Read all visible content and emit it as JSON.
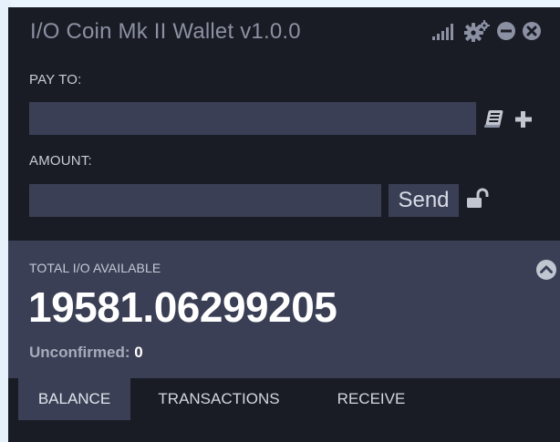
{
  "window": {
    "title": "I/O Coin Mk II Wallet v1.0.0",
    "icons": [
      "signal-icon",
      "settings-icon",
      "minimize-icon",
      "close-icon"
    ]
  },
  "pay_to": {
    "label": "PAY TO:",
    "value": "",
    "icons": [
      "address-book-icon",
      "plus-icon"
    ]
  },
  "amount": {
    "label": "AMOUNT:",
    "value": "",
    "send_label": "Send",
    "icons": [
      "lock-icon"
    ]
  },
  "balance": {
    "label": "TOTAL I/O AVAILABLE",
    "value": "19581.06299205",
    "unconfirmed_label": "Unconfirmed:",
    "unconfirmed_value": "0",
    "icons": [
      "chevron-up-icon"
    ]
  },
  "tabs": [
    {
      "label": "BALANCE",
      "active": true
    },
    {
      "label": "TRANSACTIONS",
      "active": false
    },
    {
      "label": "RECEIVE",
      "active": false
    }
  ],
  "colors": {
    "window_bg": "#1a1c25",
    "panel_bg": "#3a3f55",
    "title_text": "#8b91a3",
    "frame_bg": "#eaf4fc"
  }
}
